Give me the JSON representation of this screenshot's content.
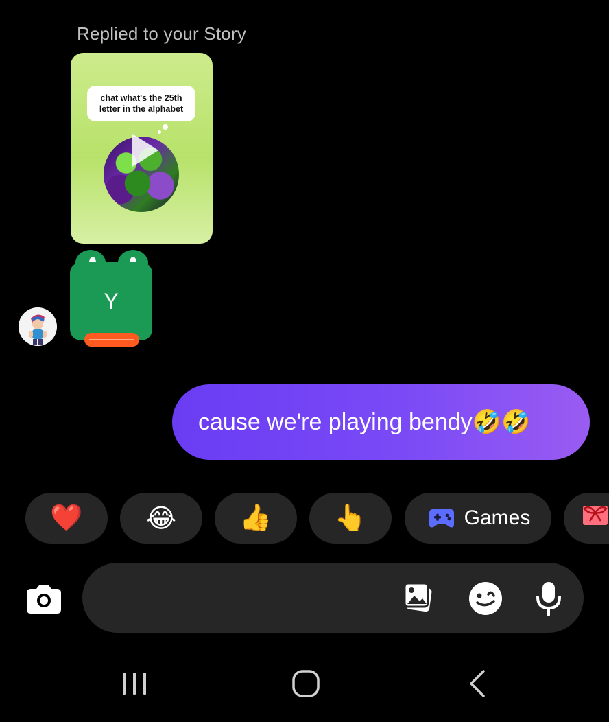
{
  "thread": {
    "replied_label": "Replied to your Story",
    "story_preview": {
      "caption": "chat what's the 25th letter in the alphabet",
      "media_icon": "play-icon"
    },
    "sticker": {
      "type": "frog-letter-sticker",
      "letter": "Y"
    },
    "sender_avatar_icon": "avatar"
  },
  "sent_message": {
    "text": "cause we're playing bendy🤣🤣"
  },
  "quick_reactions": [
    {
      "emoji": "❤️",
      "name": "heart"
    },
    {
      "emoji": "😂",
      "name": "tears-of-joy"
    },
    {
      "emoji": "👍",
      "name": "thumbs-up"
    },
    {
      "emoji": "👆",
      "name": "pointing-up"
    }
  ],
  "games_chip": {
    "label": "Games",
    "icon": "game-controller-icon",
    "icon_color": "#5b6cff"
  },
  "next_chip_icon": "gift-icon",
  "composer": {
    "placeholder": "",
    "value": "",
    "icons": [
      "camera-icon",
      "gallery-icon",
      "sticker-icon",
      "microphone-icon"
    ]
  },
  "navbar": {
    "icons": [
      "recent-apps-icon",
      "home-icon",
      "back-icon"
    ]
  },
  "colors": {
    "background": "#000000",
    "sent_bubble_start": "#6a3cf3",
    "sent_bubble_end": "#9a5cf2",
    "pill_background": "#262626",
    "frog_green": "#1a9a55",
    "frog_feet": "#ff5a1f"
  }
}
